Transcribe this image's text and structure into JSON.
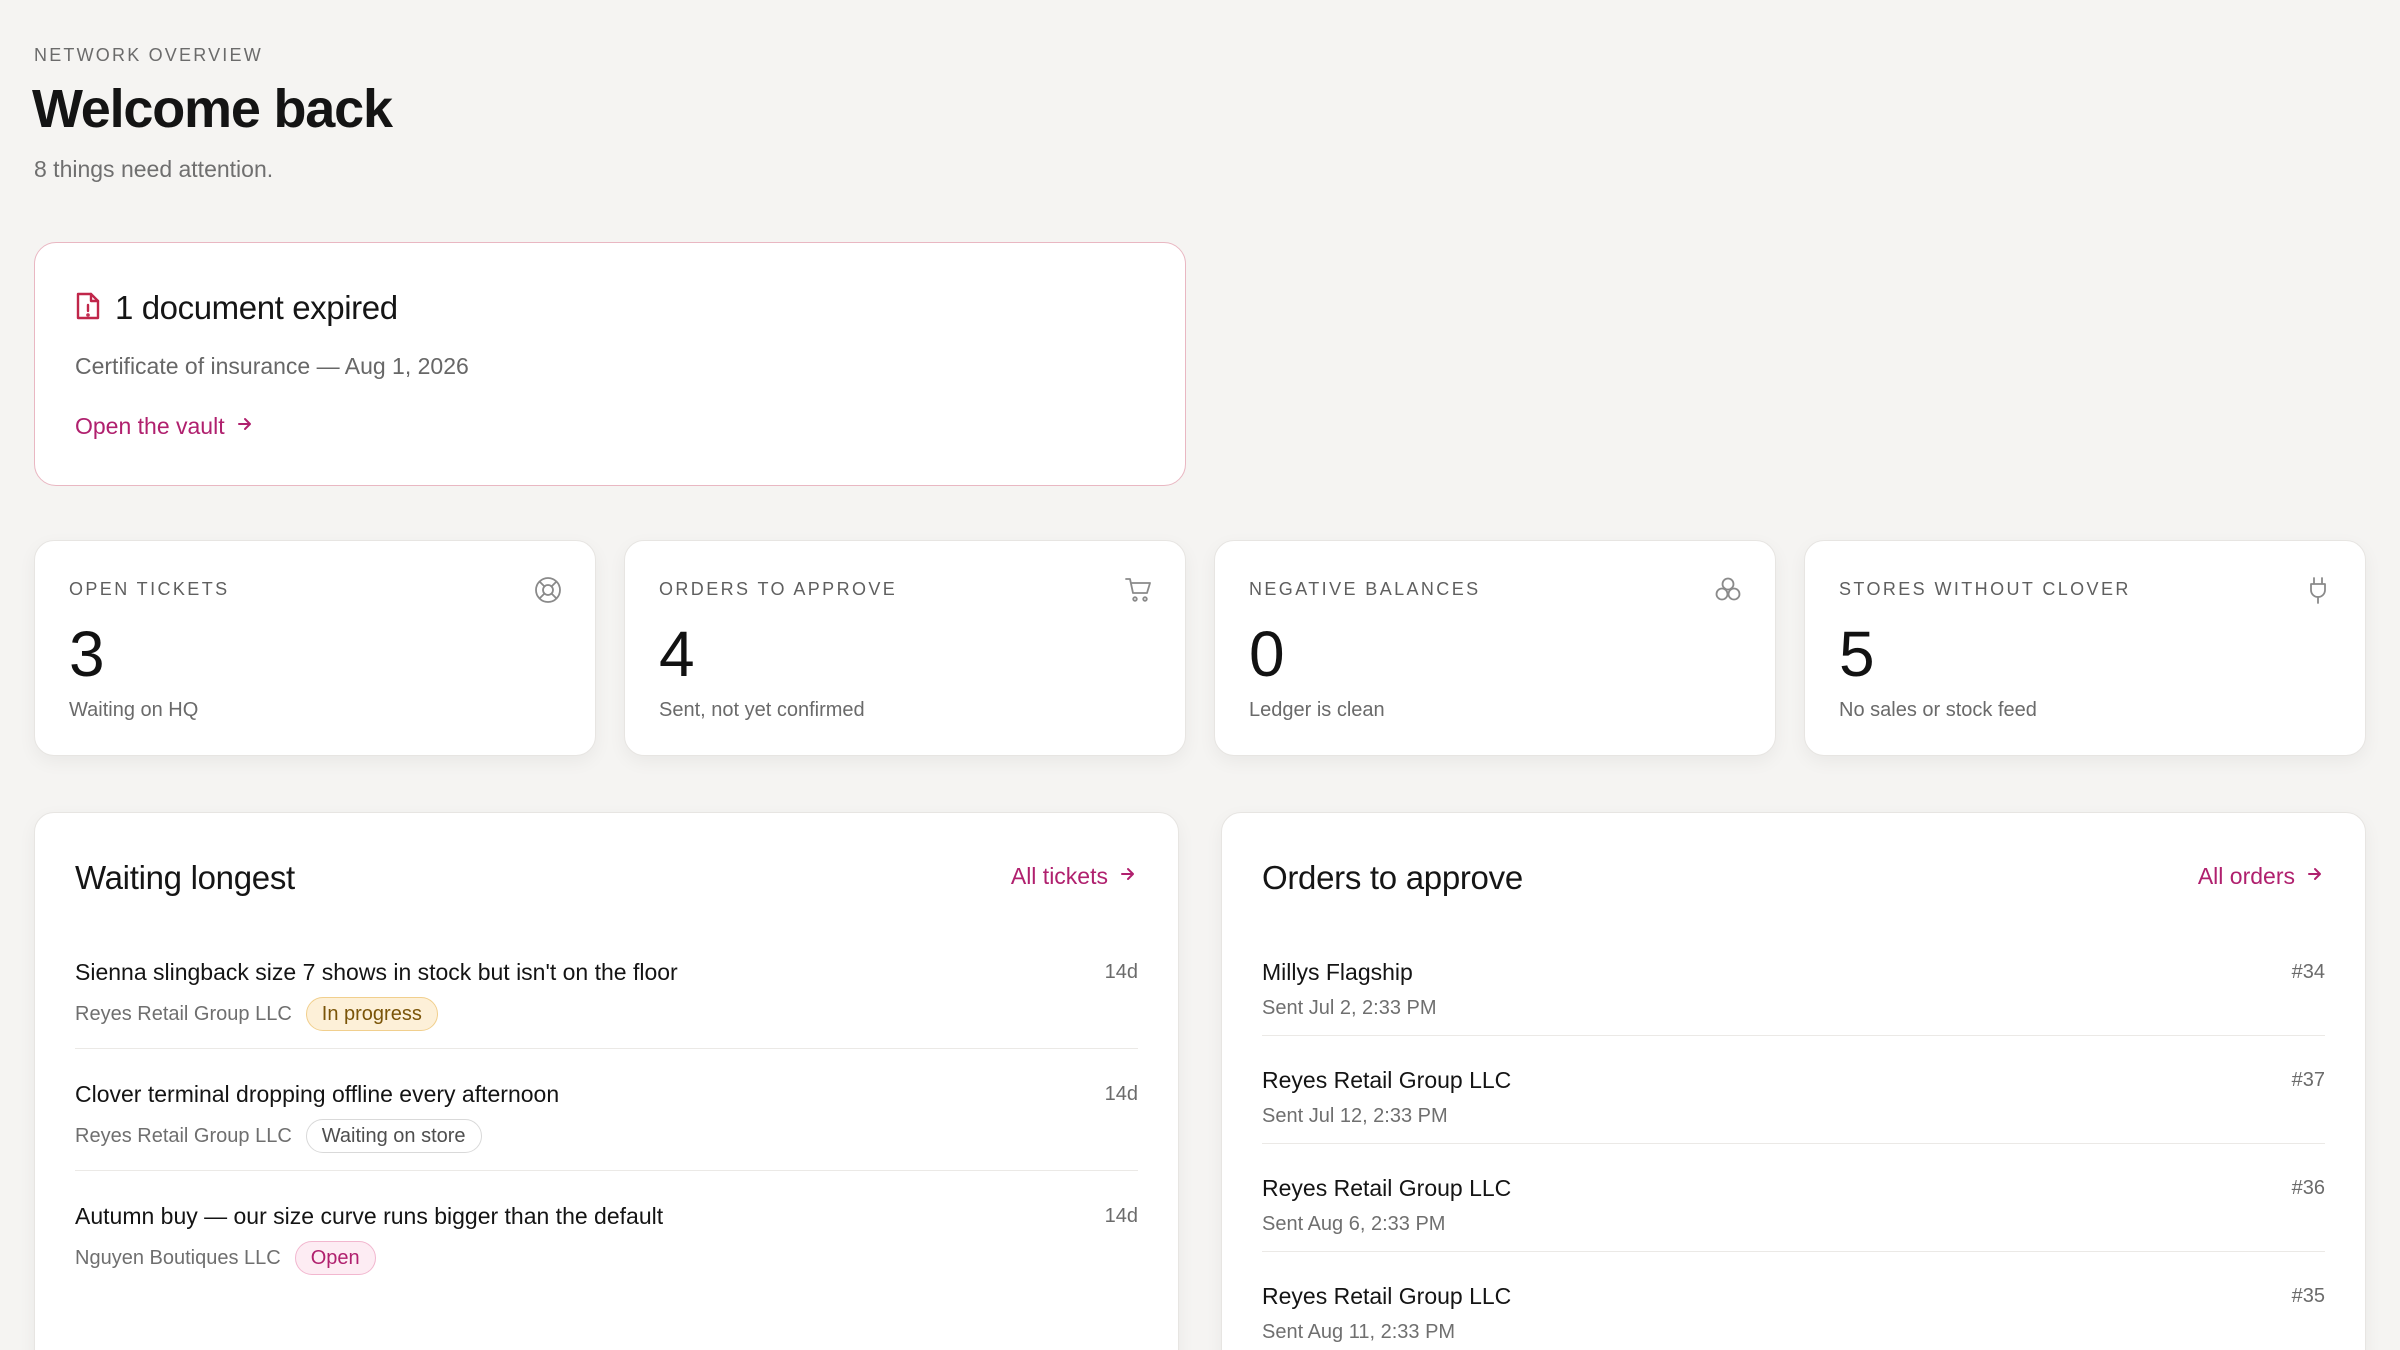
{
  "header": {
    "eyebrow": "NETWORK OVERVIEW",
    "title": "Welcome back",
    "subtitle": "8 things need attention."
  },
  "alert": {
    "icon": "document-alert-icon",
    "title": "1 document expired",
    "description": "Certificate of insurance — Aug 1, 2026",
    "link_label": "Open the vault",
    "accent_color": "#b0206e"
  },
  "stats": [
    {
      "label": "OPEN TICKETS",
      "value": "3",
      "note": "Waiting on HQ",
      "icon": "lifebuoy-icon"
    },
    {
      "label": "ORDERS TO APPROVE",
      "value": "4",
      "note": "Sent, not yet confirmed",
      "icon": "cart-icon"
    },
    {
      "label": "NEGATIVE BALANCES",
      "value": "0",
      "note": "Ledger is clean",
      "icon": "coins-icon"
    },
    {
      "label": "STORES WITHOUT CLOVER",
      "value": "5",
      "note": "No sales or stock feed",
      "icon": "plug-icon"
    }
  ],
  "waiting": {
    "title": "Waiting longest",
    "link_label": "All tickets",
    "tickets": [
      {
        "title": "Sienna slingback size 7 shows in stock but isn't on the floor",
        "store": "Reyes Retail Group LLC",
        "status": "In progress",
        "age": "14d"
      },
      {
        "title": "Clover terminal dropping offline every afternoon",
        "store": "Reyes Retail Group LLC",
        "status": "Waiting on store",
        "age": "14d"
      },
      {
        "title": "Autumn buy — our size curve runs bigger than the default",
        "store": "Nguyen Boutiques LLC",
        "status": "Open",
        "age": "14d"
      }
    ]
  },
  "orders": {
    "title": "Orders to approve",
    "link_label": "All orders",
    "items": [
      {
        "store": "Millys Flagship",
        "sent": "Sent Jul 2, 2:33 PM",
        "number": "#34"
      },
      {
        "store": "Reyes Retail Group LLC",
        "sent": "Sent Jul 12, 2:33 PM",
        "number": "#37"
      },
      {
        "store": "Reyes Retail Group LLC",
        "sent": "Sent Aug 6, 2:33 PM",
        "number": "#36"
      },
      {
        "store": "Reyes Retail Group LLC",
        "sent": "Sent Aug 11, 2:33 PM",
        "number": "#35"
      }
    ]
  }
}
